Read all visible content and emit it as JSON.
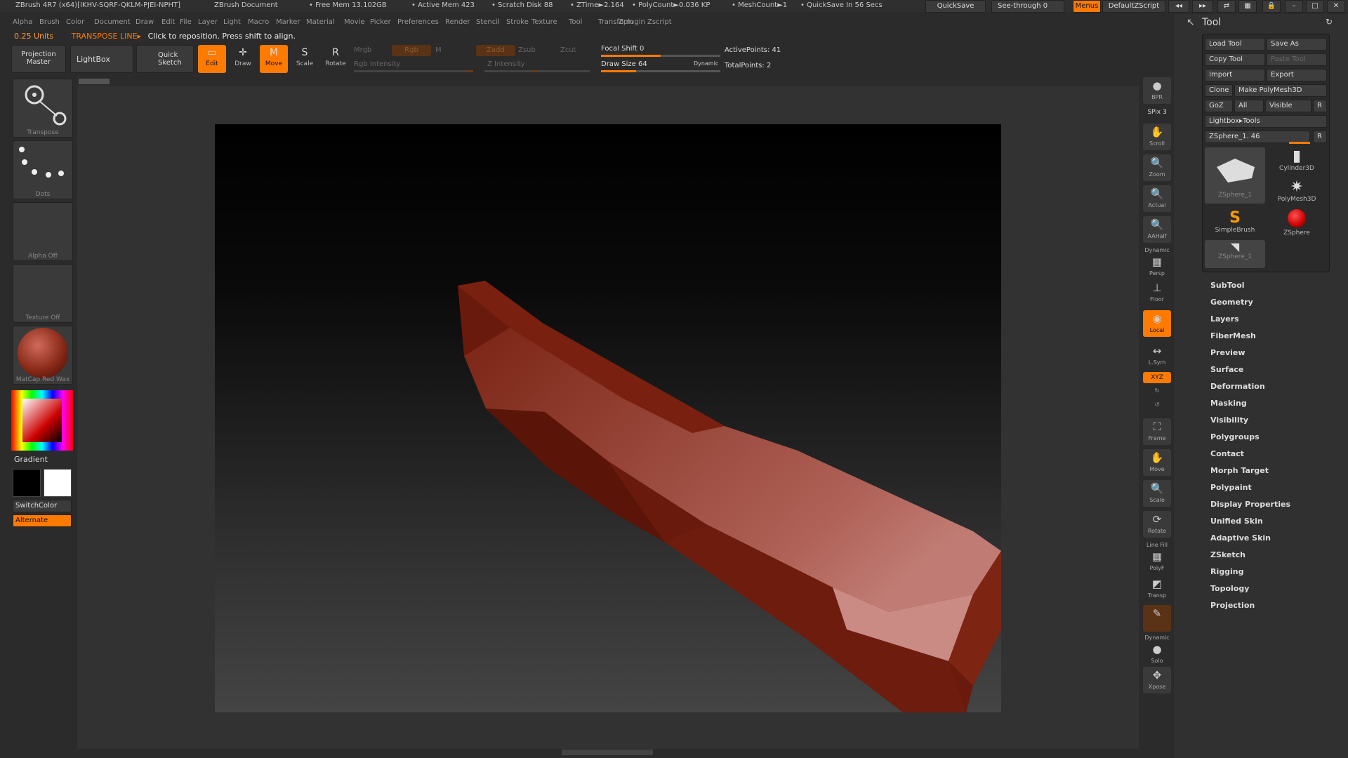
{
  "titlebar": {
    "app": "ZBrush 4R7 (x64)[IKHV-SQRF-QKLM-PJEI-NPHT]",
    "doc": "ZBrush Document",
    "free_mem": "• Free Mem 13.102GB",
    "active_mem": "• Active Mem 423",
    "scratch": "• Scratch Disk 88",
    "ztime": "• ZTime►2.164",
    "polycount": "• PolyCount►0.036 KP",
    "meshcount": "• MeshCount►1",
    "quicksave_info": "• QuickSave In 56 Secs",
    "quicksave_btn": "QuickSave",
    "seethrough": "See-through 0",
    "menus": "Menus",
    "defaultzscript": "DefaultZScript"
  },
  "menus": [
    "Alpha",
    "Brush",
    "Color",
    "Document",
    "Draw",
    "Edit",
    "File",
    "Layer",
    "Light",
    "Macro",
    "Marker",
    "Material",
    "Movie",
    "Picker",
    "Preferences",
    "Render",
    "Stencil",
    "Stroke",
    "Texture",
    "Tool",
    "Transform",
    "Zplugin",
    "Zscript"
  ],
  "status": {
    "units": "0.25 Units",
    "mode": "TRANSPOSE LINE▸",
    "hint": "Click to reposition. Press shift to align."
  },
  "toolbar": {
    "projection_master": "Projection Master",
    "lightbox": "LightBox",
    "quick_sketch": "Quick Sketch",
    "edit": "Edit",
    "draw": "Draw",
    "move": "Move",
    "scale": "Scale",
    "rotate": "Rotate",
    "mrgb": "Mrgb",
    "rgb": "Rgb",
    "m": "M",
    "rgb_intensity": "Rgb Intensity",
    "zadd": "Zadd",
    "zsub": "Zsub",
    "zcut": "Zcut",
    "z_intensity": "Z Intensity",
    "focal_shift": "Focal Shift 0",
    "draw_size": "Draw Size 64",
    "dynamic": "Dynamic",
    "active_points": "ActivePoints: 41",
    "total_points": "TotalPoints: 2",
    "focal_value": 0,
    "draw_size_value": 64
  },
  "leftshelf": {
    "transpose": "Transpose",
    "dots": "Dots",
    "alpha_off": "Alpha Off",
    "texture_off": "Texture Off",
    "matcap": "MatCap Red Wax",
    "gradient": "Gradient",
    "switchcolor": "SwitchColor",
    "alternate": "Alternate"
  },
  "rightshelf": {
    "bpr": "BPR",
    "spix": "SPix 3",
    "scroll": "Scroll",
    "zoom": "Zoom",
    "actual": "Actual",
    "aahalf": "AAHalf",
    "dynamic": "Dynamic",
    "persp": "Persp",
    "floor": "Floor",
    "local": "Local",
    "lsym": "L.Sym",
    "xyz": "XYZ",
    "frame": "Frame",
    "move": "Move",
    "scale": "Scale",
    "rotate": "Rotate",
    "linefill": "Line Fill",
    "polyf": "PolyF",
    "transp": "Transp",
    "dynamic2": "Dynamic",
    "solo": "Solo",
    "xpose": "Xpose"
  },
  "tool": {
    "title": "Tool",
    "load": "Load Tool",
    "save_as": "Save As",
    "copy": "Copy Tool",
    "paste": "Paste Tool",
    "import": "Import",
    "export": "Export",
    "clone": "Clone",
    "make_polymesh": "Make PolyMesh3D",
    "goz": "GoZ",
    "all": "All",
    "visible": "Visible",
    "r": "R",
    "lightbox_tools": "Lightbox▸Tools",
    "current": "ZSphere_1. 46",
    "current_value": 46,
    "thumbs": {
      "zsphere1": "ZSphere_1",
      "cylinder": "Cylinder3D",
      "polymesh": "PolyMesh3D",
      "simplebrush": "SimpleBrush",
      "zsphere": "ZSphere",
      "zsphere1b": "ZSphere_1"
    },
    "sections": [
      "SubTool",
      "Geometry",
      "Layers",
      "FiberMesh",
      "Preview",
      "Surface",
      "Deformation",
      "Masking",
      "Visibility",
      "Polygroups",
      "Contact",
      "Morph Target",
      "Polypaint",
      "Display Properties",
      "Unified Skin",
      "Adaptive Skin",
      "ZSketch",
      "Rigging",
      "Topology",
      "Projection"
    ]
  },
  "colors": {
    "accent": "#ff7a00",
    "mesh": "#8a2a18"
  }
}
